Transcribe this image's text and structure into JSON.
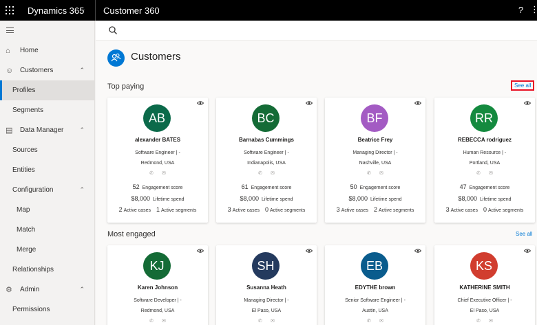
{
  "header": {
    "app_name": "Dynamics 365",
    "area_title": "Customer 360",
    "help_glyph": "?",
    "more_glyph": "⋮"
  },
  "sidebar": {
    "items": [
      {
        "label": "Home",
        "icon": "home-icon",
        "glyph": "⌂",
        "indent": 1
      },
      {
        "label": "Customers",
        "icon": "customers-icon",
        "glyph": "☺",
        "indent": 1,
        "chevron": "up"
      },
      {
        "label": "Profiles",
        "indent": 2,
        "selected": true
      },
      {
        "label": "Segments",
        "indent": 2
      },
      {
        "label": "Data Manager",
        "icon": "database-icon",
        "glyph": "▤",
        "indent": 1,
        "chevron": "up"
      },
      {
        "label": "Sources",
        "indent": 2
      },
      {
        "label": "Entities",
        "indent": 2
      },
      {
        "label": "Configuration",
        "indent": 2,
        "chevron": "up"
      },
      {
        "label": "Map",
        "indent": 3
      },
      {
        "label": "Match",
        "indent": 3
      },
      {
        "label": "Merge",
        "indent": 3
      },
      {
        "label": "Relationships",
        "indent": 2
      },
      {
        "label": "Admin",
        "icon": "gear-icon",
        "glyph": "⚙",
        "indent": 1,
        "chevron": "up"
      },
      {
        "label": "Permissions",
        "indent": 2
      }
    ]
  },
  "page": {
    "title": "Customers"
  },
  "sections": [
    {
      "title": "Top paying",
      "see_all": "See all",
      "cards": [
        {
          "initials": "AB",
          "color": "#0b6a4a",
          "name": "alexander BATES",
          "role": "Software Engineer | -",
          "location": "Redmond, USA",
          "engagement_score": "52",
          "engagement_label": "Engagement score",
          "lifetime_spend": "$8,000",
          "lifetime_label": "Lifetime spend",
          "active_cases": "2",
          "cases_label": "Active cases",
          "active_segments": "1",
          "segments_label": "Active segments"
        },
        {
          "initials": "BC",
          "color": "#146b36",
          "name": "Barnabas Cummings",
          "role": "Software Engineer | -",
          "location": "Indianapolis, USA",
          "engagement_score": "61",
          "engagement_label": "Engagement score",
          "lifetime_spend": "$8,000",
          "lifetime_label": "Lifetime spend",
          "active_cases": "3",
          "cases_label": "Active cases",
          "active_segments": "0",
          "segments_label": "Active segments"
        },
        {
          "initials": "BF",
          "color": "#a35bc3",
          "name": "Beatrice Frey",
          "role": "Managing Director | -",
          "location": "Nashville, USA",
          "engagement_score": "50",
          "engagement_label": "Engagement score",
          "lifetime_spend": "$8,000",
          "lifetime_label": "Lifetime spend",
          "active_cases": "3",
          "cases_label": "Active cases",
          "active_segments": "2",
          "segments_label": "Active segments"
        },
        {
          "initials": "RR",
          "color": "#148a3f",
          "name": "REBECCA rodriguez",
          "role": "Human Resource | -",
          "location": "Portland, USA",
          "engagement_score": "47",
          "engagement_label": "Engagement score",
          "lifetime_spend": "$8,000",
          "lifetime_label": "Lifetime spend",
          "active_cases": "3",
          "cases_label": "Active cases",
          "active_segments": "0",
          "segments_label": "Active segments"
        }
      ]
    },
    {
      "title": "Most engaged",
      "see_all": "See all",
      "cards": [
        {
          "initials": "KJ",
          "color": "#146b36",
          "name": "Karen Johnson",
          "role": "Software Developer | -",
          "location": "Redmond, USA"
        },
        {
          "initials": "SH",
          "color": "#243a5e",
          "name": "Susanna Heath",
          "role": "Managing Director | -",
          "location": "El Paso, USA"
        },
        {
          "initials": "EB",
          "color": "#0a5c8d",
          "name": "EDYTHE brown",
          "role": "Senior Software Engineer | -",
          "location": "Austin, USA"
        },
        {
          "initials": "KS",
          "color": "#d13d2f",
          "name": "KATHERINE SMITH",
          "role": "Chief Executive Officer | -",
          "location": "El Paso, USA"
        }
      ]
    }
  ]
}
